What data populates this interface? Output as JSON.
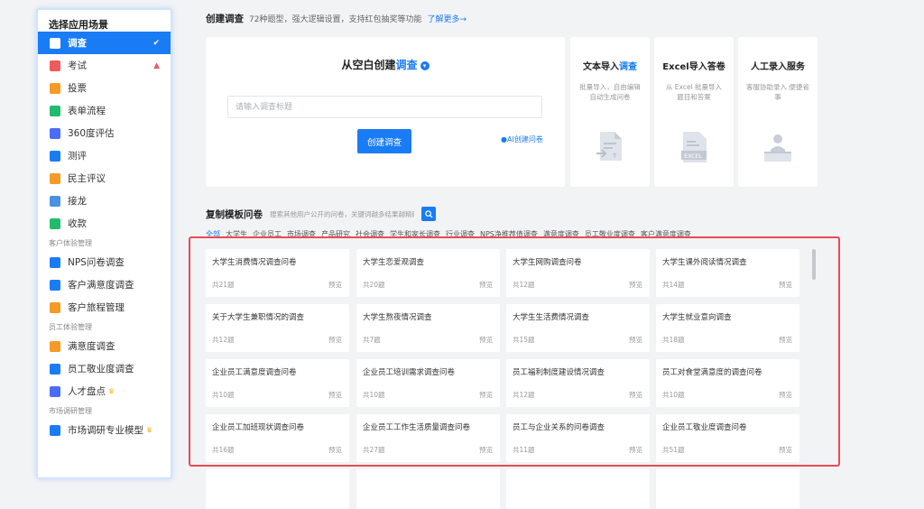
{
  "sidebar": {
    "title": "选择应用场景",
    "items": [
      {
        "label": "调查",
        "icon": "survey-icon",
        "color": "#1a7cf5",
        "active": true,
        "mark": "✓"
      },
      {
        "label": "考试",
        "icon": "exam-icon",
        "color": "#ef5a5a",
        "mark": "hot"
      },
      {
        "label": "投票",
        "icon": "vote-icon",
        "color": "#f59a23"
      },
      {
        "label": "表单流程",
        "icon": "form-icon",
        "color": "#1fbd6b"
      },
      {
        "label": "360度评估",
        "icon": "360-icon",
        "color": "#4a6cf7"
      },
      {
        "label": "测评",
        "icon": "assessment-icon",
        "color": "#1a7cf5"
      },
      {
        "label": "民主评议",
        "icon": "democratic-icon",
        "color": "#f59a23"
      },
      {
        "label": "接龙",
        "icon": "relay-icon",
        "color": "#4a90e2"
      },
      {
        "label": "收款",
        "icon": "payment-icon",
        "color": "#1fbd6b"
      }
    ],
    "group1": "客户体验管理",
    "group1_items": [
      {
        "label": "NPS问卷调查",
        "icon": "nps-icon",
        "color": "#1a7cf5"
      },
      {
        "label": "客户满意度调查",
        "icon": "customer-satisfaction-icon",
        "color": "#1a7cf5"
      },
      {
        "label": "客户旅程管理",
        "icon": "journey-icon",
        "color": "#f59a23"
      }
    ],
    "group2": "员工体验管理",
    "group2_items": [
      {
        "label": "满意度调查",
        "icon": "satisfaction-icon",
        "color": "#f59a23"
      },
      {
        "label": "员工敬业度调查",
        "icon": "employee-icon",
        "color": "#1a7cf5"
      },
      {
        "label": "人才盘点",
        "icon": "talent-icon",
        "color": "#4a6cf7",
        "crown": true
      }
    ],
    "group3": "市场调研管理",
    "group3_items": [
      {
        "label": "市场调研专业模型",
        "icon": "market-model-icon",
        "color": "#1a7cf5",
        "crown": true
      }
    ]
  },
  "header": {
    "title": "创建调查",
    "desc": "72种题型，强大逻辑设置，支持红包抽奖等功能",
    "link": "了解更多→"
  },
  "blank": {
    "title_prefix": "从空白创建",
    "title_kw": "调查",
    "input_placeholder": "请输入调查标题",
    "button": "创建调查",
    "ai": "AI创建问卷"
  },
  "side_cards": [
    {
      "title": "文本导入",
      "kw": "调查",
      "desc": "批量导入，自由编辑 自动生成问卷",
      "illus": "text-import-illustration"
    },
    {
      "title": "Excel导入答卷",
      "kw": "",
      "desc": "从 Excel 批量导入 题目和答案",
      "illus": "excel-illustration"
    },
    {
      "title": "人工录入服务",
      "kw": "",
      "desc": "客服协助录入 便捷省事",
      "illus": "service-illustration"
    }
  ],
  "templates": {
    "title": "复制模板问卷",
    "search_placeholder": "搜索其他用户公开的问卷，关键词越多结果越精确",
    "categories": [
      "全部",
      "大学生",
      "企业员工",
      "市场调查",
      "产品研究",
      "社会调查",
      "学生和家长调查",
      "行业调查",
      "NPS净推荐值调查",
      "满意度调查",
      "员工敬业度调查",
      "客户满意度调查"
    ],
    "preview_label": "预览",
    "cards": [
      {
        "title": "大学生消费情况调查问卷",
        "count": "共21题"
      },
      {
        "title": "大学生恋爱观调查",
        "count": "共20题"
      },
      {
        "title": "大学生网购调查问卷",
        "count": "共12题"
      },
      {
        "title": "大学生课外阅读情况调查",
        "count": "共14题"
      },
      {
        "title": "关于大学生兼职情况的调查",
        "count": "共12题"
      },
      {
        "title": "大学生熬夜情况调查",
        "count": "共7题"
      },
      {
        "title": "大学生生活费情况调查",
        "count": "共15题"
      },
      {
        "title": "大学生就业意向调查",
        "count": "共18题"
      },
      {
        "title": "企业员工满意度调查问卷",
        "count": "共10题"
      },
      {
        "title": "企业员工培训需求调查问卷",
        "count": "共10题"
      },
      {
        "title": "员工福利制度建设情况调查",
        "count": "共12题"
      },
      {
        "title": "员工对食堂满意度的调查问卷",
        "count": "共10题"
      },
      {
        "title": "企业员工加班现状调查问卷",
        "count": "共16题"
      },
      {
        "title": "企业员工工作生活质量调查问卷",
        "count": "共27题"
      },
      {
        "title": "员工与企业关系的问卷调查",
        "count": "共11题"
      },
      {
        "title": "企业员工敬业度调查问卷",
        "count": "共51题"
      },
      {
        "title": "",
        "count": ""
      },
      {
        "title": "",
        "count": ""
      },
      {
        "title": "",
        "count": ""
      },
      {
        "title": "",
        "count": ""
      }
    ]
  },
  "colors": {
    "accent": "#1a7cf5",
    "highlight": "#e94b57"
  }
}
